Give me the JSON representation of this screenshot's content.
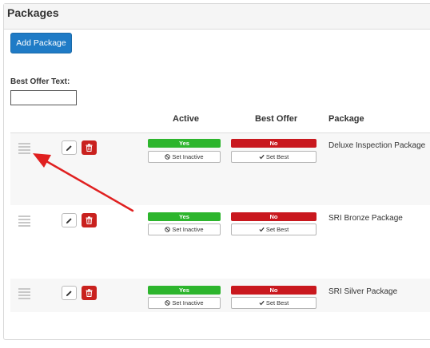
{
  "panel": {
    "title": "Packages"
  },
  "toolbar": {
    "add_label": "Add Package"
  },
  "best_offer": {
    "label": "Best Offer Text:",
    "value": ""
  },
  "columns": {
    "active": "Active",
    "best_offer": "Best Offer",
    "package": "Package"
  },
  "rows": [
    {
      "active_status": "Yes",
      "active_action": "Set Inactive",
      "best_status": "No",
      "best_action": "Set Best",
      "package": "Deluxe Inspection Package"
    },
    {
      "active_status": "Yes",
      "active_action": "Set Inactive",
      "best_status": "No",
      "best_action": "Set Best",
      "package": "SRI Bronze Package"
    },
    {
      "active_status": "Yes",
      "active_action": "Set Inactive",
      "best_status": "No",
      "best_action": "Set Best",
      "package": "SRI Silver Package"
    }
  ],
  "icons": {
    "drag": "drag-handle-icon",
    "edit": "pencil-icon",
    "delete": "trash-icon",
    "ban": "ban-icon",
    "check": "check-icon"
  },
  "colors": {
    "primary": "#1f7bc6",
    "success": "#2db52d",
    "danger": "#c9181e",
    "annotation": "#e02020"
  }
}
